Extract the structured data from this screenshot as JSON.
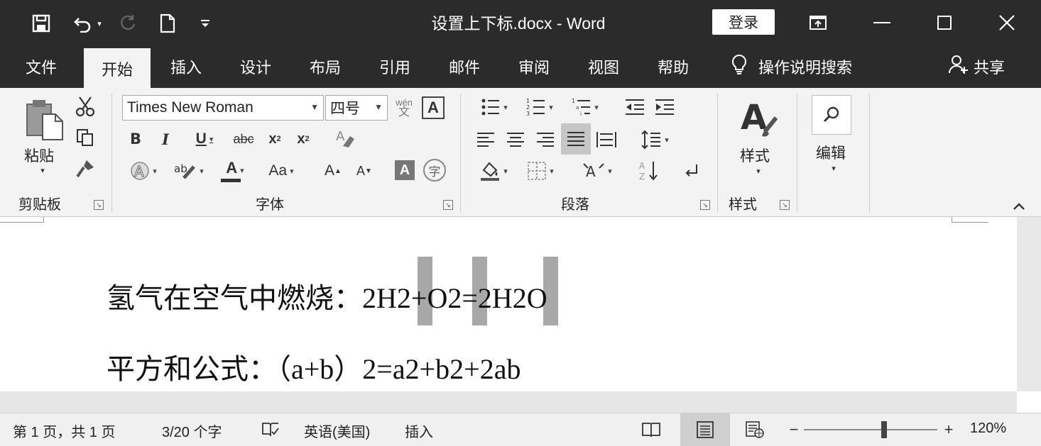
{
  "title_bar": {
    "doc_title": "设置上下标.docx  -  Word",
    "login_label": "登录",
    "quick_access": [
      "save-icon",
      "undo-icon",
      "redo-icon",
      "new-doc-icon",
      "customize-icon"
    ]
  },
  "tabs": [
    {
      "label": "文件"
    },
    {
      "label": "开始",
      "active": true
    },
    {
      "label": "插入"
    },
    {
      "label": "设计"
    },
    {
      "label": "布局"
    },
    {
      "label": "引用"
    },
    {
      "label": "邮件"
    },
    {
      "label": "审阅"
    },
    {
      "label": "视图"
    },
    {
      "label": "帮助"
    }
  ],
  "tell_me": "操作说明搜索",
  "share": "共享",
  "ribbon": {
    "clipboard": {
      "label": "剪贴板",
      "paste_label": "粘贴"
    },
    "font": {
      "label": "字体",
      "font_name": "Times New Roman",
      "font_size": "四号",
      "wen": "wén",
      "wen_char": "文",
      "a_box": "A"
    },
    "paragraph": {
      "label": "段落"
    },
    "styles": {
      "label": "样式",
      "styles_btn": "样式"
    },
    "editing": {
      "editing_btn": "编辑"
    }
  },
  "document": {
    "line1": "氢气在空气中燃烧：2H2+O2=2H2O",
    "line2": "平方和公式：（a+b）2=a2+b2+2ab"
  },
  "status_bar": {
    "page": "第 1 页，共 1 页",
    "words": "3/20 个字",
    "language": "英语(美国)",
    "mode": "插入",
    "zoom": "120%",
    "zoom_level_fraction": 0.6
  }
}
